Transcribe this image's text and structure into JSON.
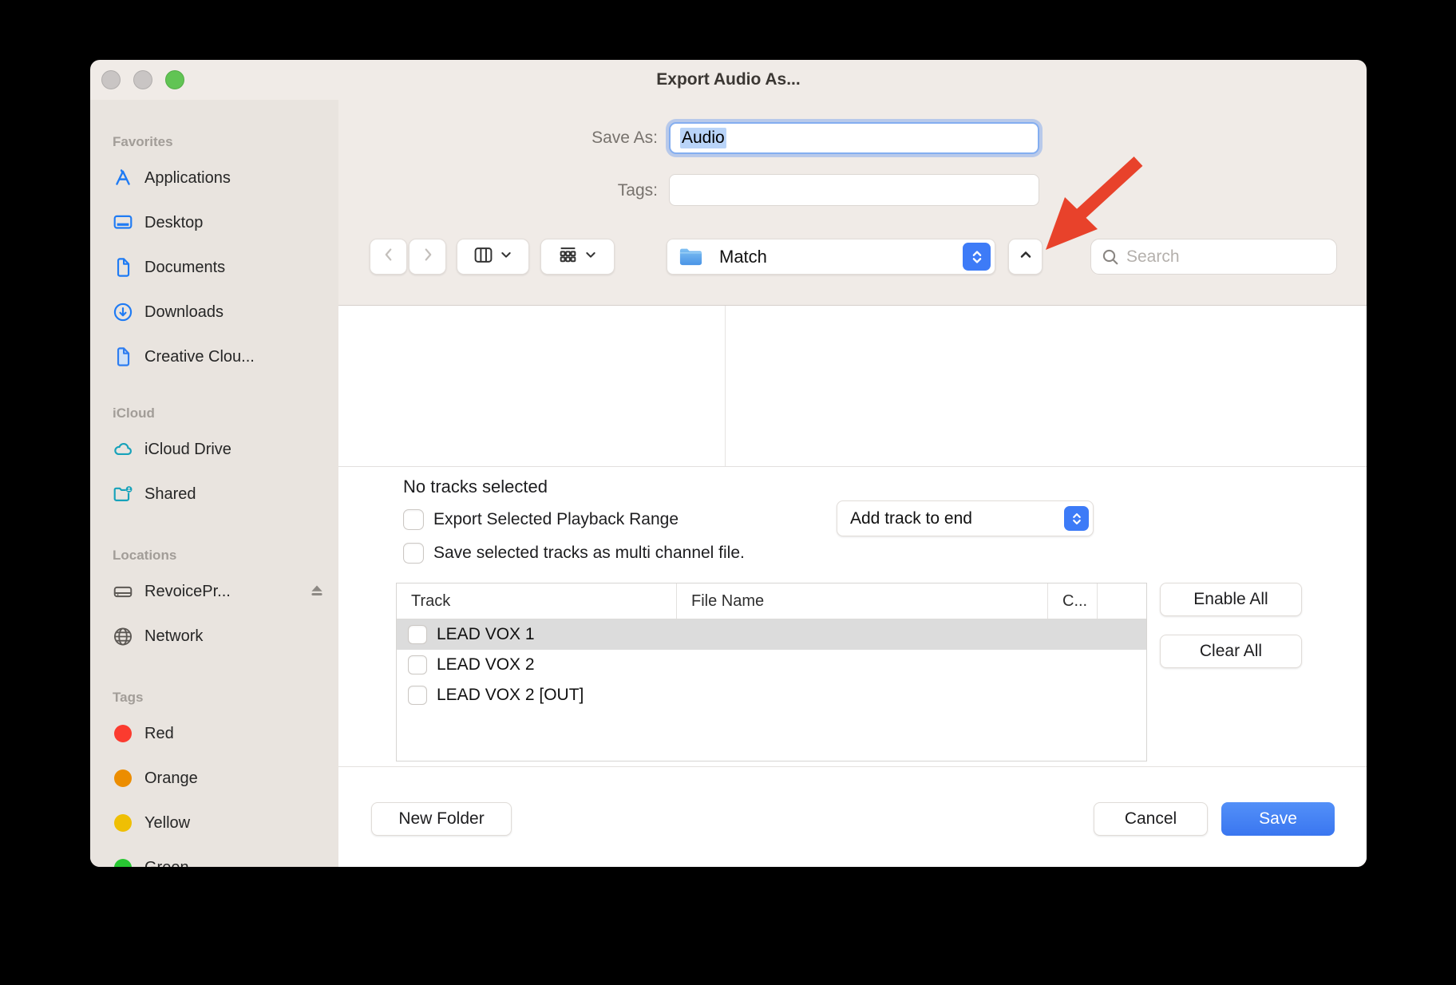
{
  "window": {
    "title": "Export Audio As..."
  },
  "form": {
    "save_as_label": "Save As:",
    "save_as_value": "Audio",
    "tags_label": "Tags:"
  },
  "toolbar": {
    "location_value": "Match",
    "search_placeholder": "Search"
  },
  "sidebar": {
    "sections": [
      {
        "label": "Favorites",
        "items": [
          {
            "icon": "appstore-icon",
            "label": "Applications"
          },
          {
            "icon": "desktop-icon",
            "label": "Desktop"
          },
          {
            "icon": "document-icon",
            "label": "Documents"
          },
          {
            "icon": "downloads-icon",
            "label": "Downloads"
          },
          {
            "icon": "file-icon",
            "label": "Creative Clou..."
          }
        ]
      },
      {
        "label": "iCloud",
        "items": [
          {
            "icon": "cloud-icon",
            "label": "iCloud Drive"
          },
          {
            "icon": "shared-folder-icon",
            "label": "Shared"
          }
        ]
      },
      {
        "label": "Locations",
        "items": [
          {
            "icon": "drive-icon",
            "label": "RevoicePr..."
          },
          {
            "icon": "globe-icon",
            "label": "Network"
          }
        ]
      },
      {
        "label": "Tags",
        "items": [
          {
            "icon": "tag-dot",
            "label": "Red",
            "color": "#fb3b2f"
          },
          {
            "icon": "tag-dot",
            "label": "Orange",
            "color": "#ec8d00"
          },
          {
            "icon": "tag-dot",
            "label": "Yellow",
            "color": "#efbf04"
          },
          {
            "icon": "tag-dot",
            "label": "Green",
            "color": "#28c732"
          }
        ]
      }
    ]
  },
  "accessory": {
    "status": "No tracks selected",
    "checkbox_playback_range": "Export Selected Playback Range",
    "checkbox_multichannel": "Save selected tracks as multi channel file.",
    "popup_value": "Add track to end",
    "enable_all": "Enable All",
    "clear_all": "Clear All",
    "table": {
      "columns": [
        "Track",
        "File Name",
        "C..."
      ],
      "rows": [
        {
          "track": "LEAD VOX 1",
          "selected": true
        },
        {
          "track": "LEAD VOX 2",
          "selected": false
        },
        {
          "track": "LEAD VOX 2 [OUT]",
          "selected": false
        }
      ]
    }
  },
  "footer": {
    "new_folder": "New Folder",
    "cancel": "Cancel",
    "save": "Save"
  },
  "colors": {
    "accent_blue": "#3d7bf7",
    "save_button_blue": "#3a76f0",
    "arrow_red": "#e8422b",
    "selection_blue": "#b9d4f8",
    "titlebar_beige": "#f0ebe7",
    "sidebar_beige": "#e9e4df",
    "selected_row_gray": "#dcdcdc",
    "traffic_green": "#61c454",
    "traffic_gray": "#c9c5c4"
  }
}
